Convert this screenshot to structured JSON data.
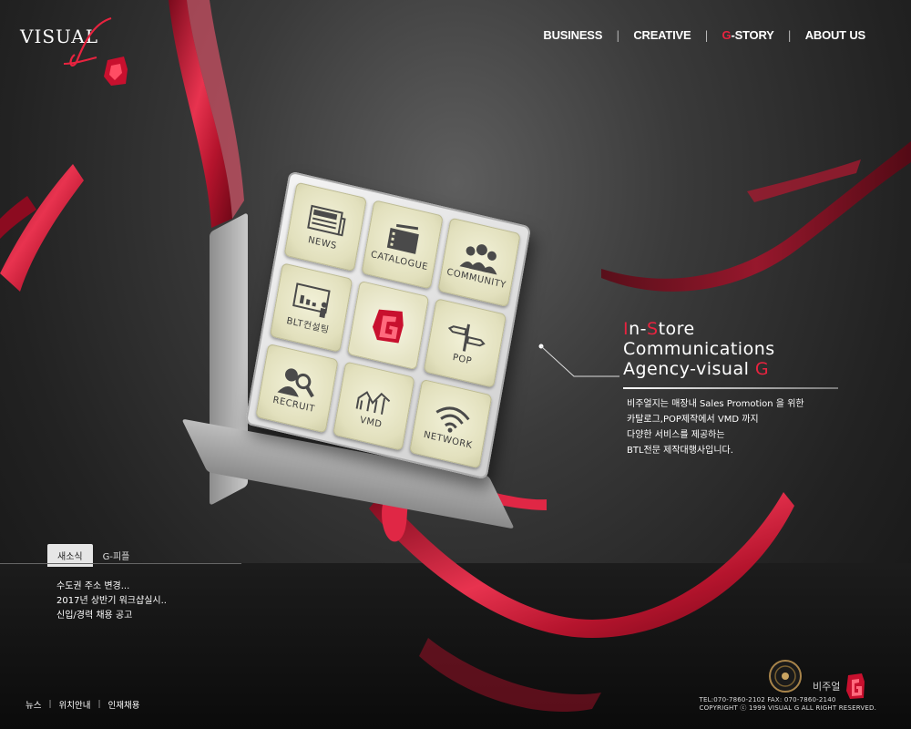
{
  "brand": {
    "logo_text": "VISUAL",
    "logo_mark_letters": "G"
  },
  "nav": [
    {
      "label": "BUSINESS",
      "highlight": ""
    },
    {
      "label": "CREATIVE",
      "highlight": ""
    },
    {
      "label": "-STORY",
      "highlight": "G"
    },
    {
      "label": "ABOUT US",
      "highlight": ""
    }
  ],
  "tiles": {
    "news": "NEWS",
    "catalogue": "CATALOGUE",
    "community": "COMMUNITY",
    "blt": "BLT컨설팅",
    "pop": "POP",
    "recruit": "RECRUIT",
    "vmd": "VMD",
    "network": "NETWORK"
  },
  "tagline": {
    "line1_red": "I",
    "line1_a": "n-",
    "line1_red2": "S",
    "line1_b": "tore",
    "line2": "Communications",
    "line3": "Agency-visual ",
    "line3_red": "G"
  },
  "description": [
    "비주얼지는 매장내 Sales Promotion 을 위한",
    "카탈로그,POP제작에서 VMD 까지",
    "다양한 서비스를 제공하는",
    "BTL전문 제작대행사입니다."
  ],
  "news_box": {
    "tabs": [
      "새소식",
      "G-피플"
    ],
    "items": [
      "수도권 주소 변경...",
      "2017년 상반기 워크샵실시..",
      "신입/경력 채용 공고"
    ]
  },
  "footer": {
    "links": [
      "뉴스",
      "위치안내",
      "인재채용"
    ],
    "contact": "TEL:070-7860-2102  FAX: 070-7860-2140",
    "copyright": "COPYRIGHT ⓒ 1999 VISUAL G ALL RIGHT RESERVED.",
    "logo_text": "비주얼"
  },
  "colors": {
    "accent": "#e8233f",
    "ribbon": "#d01a36",
    "tile": "#e8e6c4"
  },
  "icons": [
    "newspaper-icon",
    "catalogue-icon",
    "community-icon",
    "presentation-icon",
    "g-logo-icon",
    "signpost-icon",
    "recruit-icon",
    "chart-icon",
    "wifi-icon"
  ]
}
